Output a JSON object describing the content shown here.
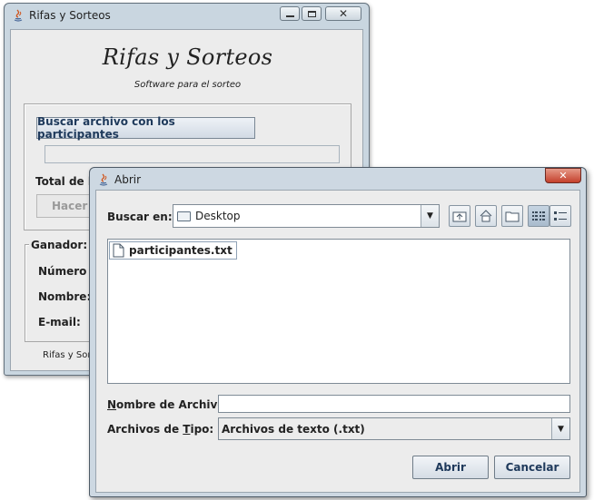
{
  "main_window": {
    "title": "Rifas y Sorteos",
    "heading": "Rifas y Sorteos",
    "subtitle": "Software para el sorteo",
    "browse_button": "Buscar archivo con los participantes",
    "total_label": "Total de bo",
    "draw_button": "Hacer S",
    "winner_group": "Ganador:",
    "number_label": "Número d",
    "name_label": "Nombre:",
    "email_label": "E-mail:",
    "footer": "Rifas y Sort",
    "caption_buttons": [
      "minimize-icon",
      "maximize-icon",
      "close-icon"
    ]
  },
  "dialog": {
    "title": "Abrir",
    "look_in_label": "Buscar en:",
    "look_in_value": "Desktop",
    "toolbar": [
      "up-folder-icon",
      "home-icon",
      "new-folder-icon",
      "list-view-icon",
      "details-view-icon"
    ],
    "files": [
      {
        "name": "participantes.txt",
        "icon": "file-icon",
        "selected": true
      }
    ],
    "filename_label_first": "N",
    "filename_label_rest": "ombre de Archivo:",
    "filename_value": "",
    "filetype_label_start": "Archivos de ",
    "filetype_label_mnemonic": "T",
    "filetype_label_end": "ipo:",
    "filetype_value": "Archivos de texto (.txt)",
    "open_button": "Abrir",
    "cancel_button": "Cancelar",
    "close_button": "close-icon"
  }
}
